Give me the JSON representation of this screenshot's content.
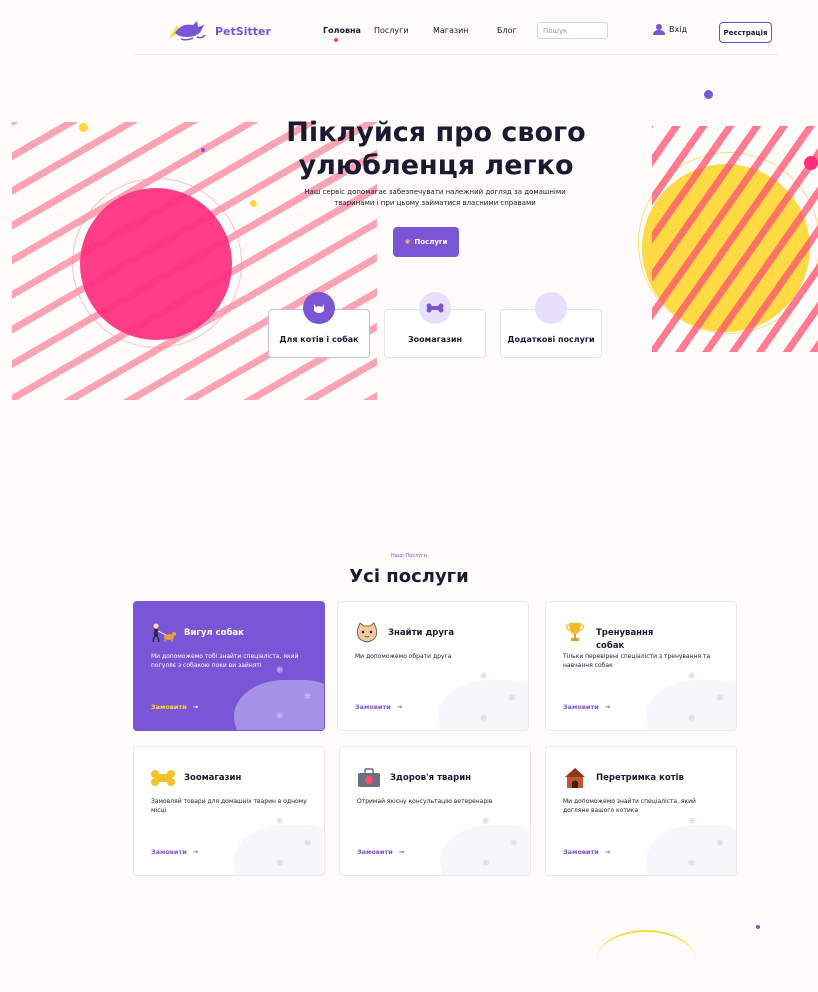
{
  "header": {
    "logo": "PetSitter",
    "nav": [
      "Головна",
      "Послуги",
      "Магазин",
      "Блог"
    ],
    "search_placeholder": "Пошук",
    "login": "Вхід",
    "register": "Реєстрація"
  },
  "hero": {
    "title_line1": "Піклуйся про свого",
    "title_line2": "улюбленця легко",
    "subtitle_line1": "Наш сервіс допомагає забезпечувати належний догляд за домашніми",
    "subtitle_line2": "тваринами і при цьому займатися власними справами",
    "cta": "Послуги",
    "categories": [
      "Для котів і собак",
      "Зоомагазин",
      "Додаткові послуги"
    ]
  },
  "services": {
    "label": "Наші Послуги",
    "title": "Усі послуги",
    "order_label": "Замовити",
    "cards": [
      {
        "title": "Вигул собак",
        "desc": "Ми допоможемо тобі знайти спеціаліста, який погуляє з собакою поки ви зайняті",
        "icon": "dog-walking-icon"
      },
      {
        "title": "Знайти друга",
        "desc": "Ми допоможемо обрати друга",
        "icon": "cat-face-icon"
      },
      {
        "title": "Тренування собак",
        "desc": "Тільки перевірені спеціалісти з тренування та навчання собак",
        "icon": "trophy-icon"
      },
      {
        "title": "Зоомагазин",
        "desc": "Замовляй товари для домашніх тварин в одному місці",
        "icon": "bone-icon"
      },
      {
        "title": "Здоров'я тварин",
        "desc": "Отримай якісну консультацію ветеренарів",
        "icon": "vet-kit-icon"
      },
      {
        "title": "Перетримка котів",
        "desc": "Ми допоможемо знайти спеціаліста, який догляне вашого котика",
        "icon": "pet-house-icon"
      }
    ]
  },
  "colors": {
    "accent": "#7a55d6",
    "pink": "#ff2d7e",
    "yellow": "#ffd83a"
  }
}
